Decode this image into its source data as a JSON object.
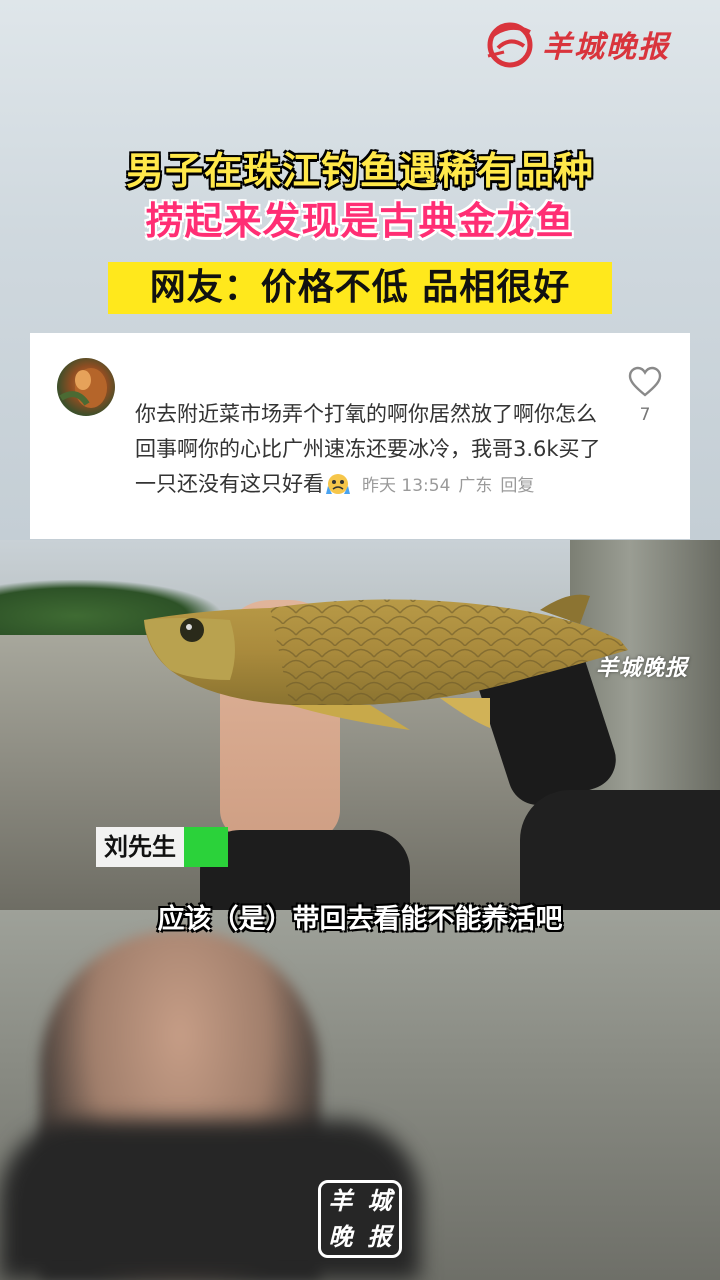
{
  "brand": {
    "name": "羊城晚报",
    "bottom_logo_chars": [
      "羊",
      "城",
      "晚",
      "报"
    ],
    "color": "#d9343c"
  },
  "headline": {
    "line1": "男子在珠江钓鱼遇稀有品种",
    "line2": "捞起来发现是古典金龙鱼",
    "line3": "网友：价格不低 品相很好"
  },
  "comment": {
    "text": "你去附近菜市场弄个打氧的啊你居然放了啊你怎么回事啊你的心比广州速冻还要冰冷，我哥3.6k买了一只还没有这只好看",
    "emoji": "crying-face-emoji",
    "time": "昨天 13:54",
    "location": "广东",
    "reply_label": "回复",
    "like_count": "7"
  },
  "photo": {
    "watermark": "羊城晚报"
  },
  "speaker": {
    "name": "刘先生"
  },
  "subtitle": "应该（是）带回去看能不能养活吧"
}
